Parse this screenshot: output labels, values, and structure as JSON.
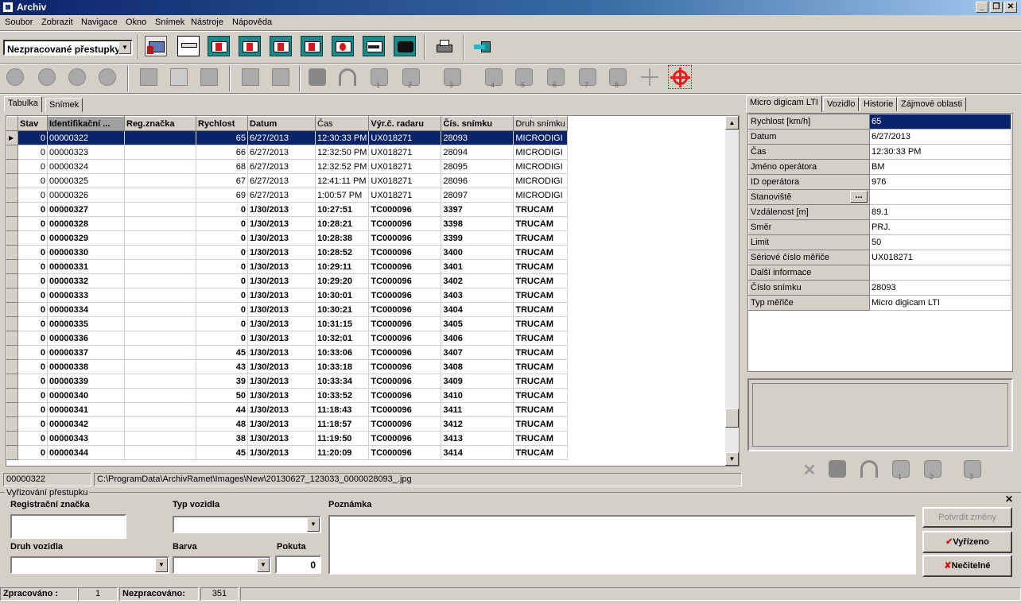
{
  "window": {
    "title": "Archiv",
    "buttons": [
      "_",
      "❐",
      "✕"
    ]
  },
  "menu": [
    "Soubor",
    "Zobrazit",
    "Navigace",
    "Okno",
    "Snímek",
    "Nástroje",
    "Nápověda"
  ],
  "filter": {
    "selected": "Nezpracované přestupky"
  },
  "toolbar2_numbers": [
    "1",
    "2",
    "3",
    "4",
    "5",
    "6",
    "7",
    "8"
  ],
  "left_tabs": [
    "Tabulka",
    "Snímek"
  ],
  "table": {
    "columns": [
      "Stav",
      "Identifikační ...",
      "Reg.značka",
      "Rychlost",
      "Datum",
      "Čas",
      "Výr.č. radaru",
      "Čís. snímku",
      "Druh snímku"
    ],
    "rows": [
      [
        "0",
        "00000322",
        "",
        "65",
        "6/27/2013",
        "12:30:33 PM",
        "UX018271",
        "28093",
        "MICRODIGI"
      ],
      [
        "0",
        "00000323",
        "",
        "66",
        "6/27/2013",
        "12:32:50 PM",
        "UX018271",
        "28094",
        "MICRODIGI"
      ],
      [
        "0",
        "00000324",
        "",
        "68",
        "6/27/2013",
        "12:32:52 PM",
        "UX018271",
        "28095",
        "MICRODIGI"
      ],
      [
        "0",
        "00000325",
        "",
        "67",
        "6/27/2013",
        "12:41:11 PM",
        "UX018271",
        "28096",
        "MICRODIGI"
      ],
      [
        "0",
        "00000326",
        "",
        "69",
        "6/27/2013",
        "1:00:57 PM",
        "UX018271",
        "28097",
        "MICRODIGI"
      ],
      [
        "0",
        "00000327",
        "",
        "0",
        "1/30/2013",
        "10:27:51",
        "TC000096",
        "3397",
        "TRUCAM"
      ],
      [
        "0",
        "00000328",
        "",
        "0",
        "1/30/2013",
        "10:28:21",
        "TC000096",
        "3398",
        "TRUCAM"
      ],
      [
        "0",
        "00000329",
        "",
        "0",
        "1/30/2013",
        "10:28:38",
        "TC000096",
        "3399",
        "TRUCAM"
      ],
      [
        "0",
        "00000330",
        "",
        "0",
        "1/30/2013",
        "10:28:52",
        "TC000096",
        "3400",
        "TRUCAM"
      ],
      [
        "0",
        "00000331",
        "",
        "0",
        "1/30/2013",
        "10:29:11",
        "TC000096",
        "3401",
        "TRUCAM"
      ],
      [
        "0",
        "00000332",
        "",
        "0",
        "1/30/2013",
        "10:29:20",
        "TC000096",
        "3402",
        "TRUCAM"
      ],
      [
        "0",
        "00000333",
        "",
        "0",
        "1/30/2013",
        "10:30:01",
        "TC000096",
        "3403",
        "TRUCAM"
      ],
      [
        "0",
        "00000334",
        "",
        "0",
        "1/30/2013",
        "10:30:21",
        "TC000096",
        "3404",
        "TRUCAM"
      ],
      [
        "0",
        "00000335",
        "",
        "0",
        "1/30/2013",
        "10:31:15",
        "TC000096",
        "3405",
        "TRUCAM"
      ],
      [
        "0",
        "00000336",
        "",
        "0",
        "1/30/2013",
        "10:32:01",
        "TC000096",
        "3406",
        "TRUCAM"
      ],
      [
        "0",
        "00000337",
        "",
        "45",
        "1/30/2013",
        "10:33:06",
        "TC000096",
        "3407",
        "TRUCAM"
      ],
      [
        "0",
        "00000338",
        "",
        "43",
        "1/30/2013",
        "10:33:18",
        "TC000096",
        "3408",
        "TRUCAM"
      ],
      [
        "0",
        "00000339",
        "",
        "39",
        "1/30/2013",
        "10:33:34",
        "TC000096",
        "3409",
        "TRUCAM"
      ],
      [
        "0",
        "00000340",
        "",
        "50",
        "1/30/2013",
        "10:33:52",
        "TC000096",
        "3410",
        "TRUCAM"
      ],
      [
        "0",
        "00000341",
        "",
        "44",
        "1/30/2013",
        "11:18:43",
        "TC000096",
        "3411",
        "TRUCAM"
      ],
      [
        "0",
        "00000342",
        "",
        "48",
        "1/30/2013",
        "11:18:57",
        "TC000096",
        "3412",
        "TRUCAM"
      ],
      [
        "0",
        "00000343",
        "",
        "38",
        "1/30/2013",
        "11:19:50",
        "TC000096",
        "3413",
        "TRUCAM"
      ],
      [
        "0",
        "00000344",
        "",
        "45",
        "1/30/2013",
        "11:20:09",
        "TC000096",
        "3414",
        "TRUCAM"
      ]
    ]
  },
  "pathbar": {
    "id": "00000322",
    "path": "C:\\ProgramData\\ArchivRamet\\Images\\New\\20130627_123033_0000028093_.jpg"
  },
  "right_tabs": [
    "Micro digicam LTI",
    "Vozidlo",
    "Historie",
    "Zájmové oblasti"
  ],
  "props": [
    {
      "k": "Rychlost [km/h]",
      "v": "65"
    },
    {
      "k": "Datum",
      "v": "6/27/2013"
    },
    {
      "k": "Čas",
      "v": "12:30:33 PM"
    },
    {
      "k": "Jméno operátora",
      "v": "BM"
    },
    {
      "k": "ID operátora",
      "v": "976"
    },
    {
      "k": "Stanoviště",
      "v": ""
    },
    {
      "k": "Vzdálenost [m]",
      "v": "89.1"
    },
    {
      "k": "Směr",
      "v": "PRJ."
    },
    {
      "k": "Limit",
      "v": "50"
    },
    {
      "k": "Sériové číslo měřiče",
      "v": "UX018271"
    },
    {
      "k": "Další informace",
      "v": ""
    },
    {
      "k": "Číslo snímku",
      "v": "28093"
    },
    {
      "k": "Typ měřiče",
      "v": "Micro digicam LTI"
    }
  ],
  "ellipsis": "...",
  "bottom_tools": [
    "1",
    "2",
    "3"
  ],
  "form": {
    "title": "Vyřizování přestupku",
    "reg_label": "Registrační značka",
    "type_label": "Typ vozidla",
    "note_label": "Poznámka",
    "kind_label": "Druh vozidla",
    "color_label": "Barva",
    "fine_label": "Pokuta",
    "fine_value": "0",
    "confirm_btn": "Potvrdit změny",
    "done_btn": "Vyřízeno",
    "unreadable_btn": "Nečitelné"
  },
  "status": {
    "processed_label": "Zpracováno :",
    "processed": "1",
    "unprocessed_label": "Nezpracováno:",
    "unprocessed": "351"
  }
}
